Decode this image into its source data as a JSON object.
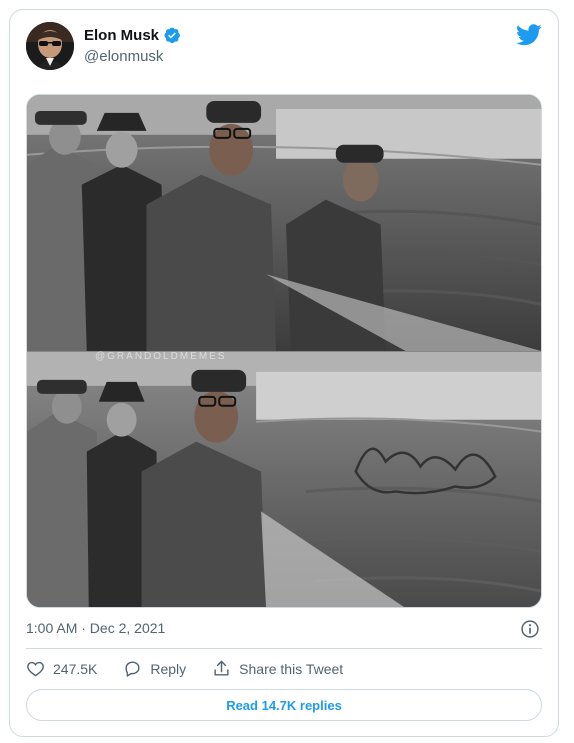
{
  "author": {
    "name": "Elon Musk",
    "handle": "@elonmusk",
    "verified": true,
    "avatar_icon": "profile-photo",
    "brand_icon": "twitter-bird-icon",
    "brand_color": "#1d9bf0"
  },
  "media": {
    "watermark": "@GRANDOLDMEMES"
  },
  "tweet": {
    "timestamp": "1:00 AM · Dec 2, 2021"
  },
  "actions": {
    "likes": "247.5K",
    "reply_label": "Reply",
    "share_label": "Share this Tweet"
  },
  "footer": {
    "read_replies_label": "Read 14.7K replies"
  }
}
